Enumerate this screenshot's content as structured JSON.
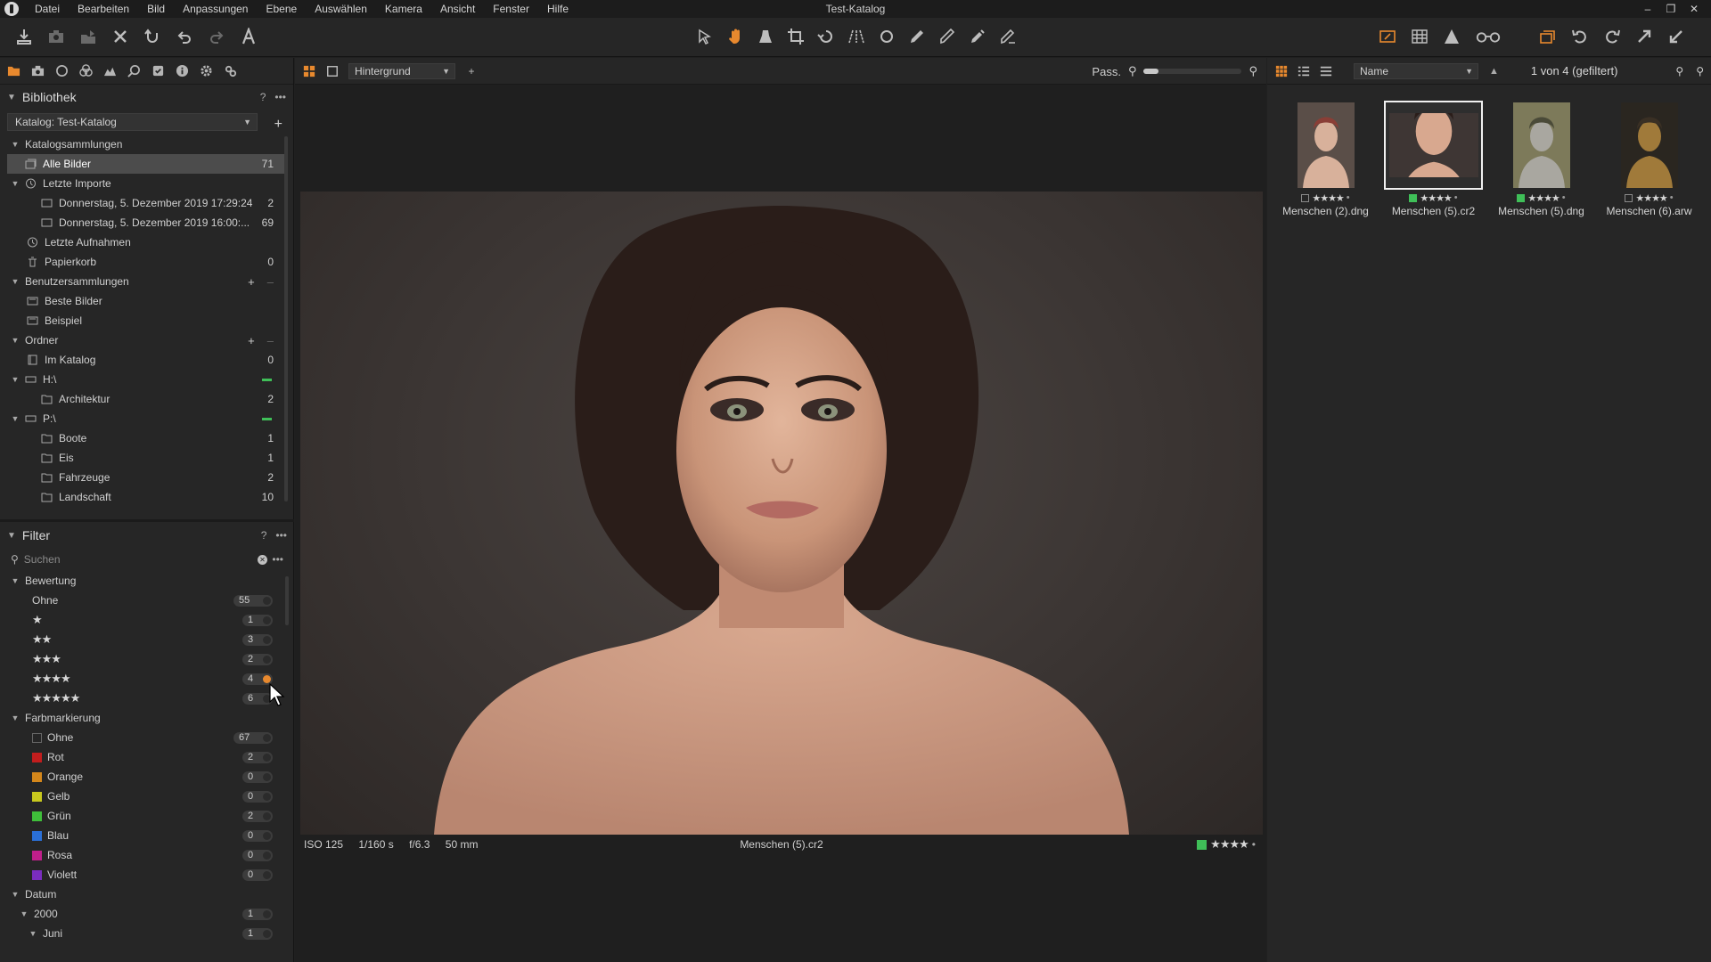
{
  "window": {
    "title": "Test-Katalog"
  },
  "menu": [
    "Datei",
    "Bearbeiten",
    "Bild",
    "Anpassungen",
    "Ebene",
    "Auswählen",
    "Kamera",
    "Ansicht",
    "Fenster",
    "Hilfe"
  ],
  "colors": {
    "accent": "#e8892e",
    "green_label": "#3fbf58",
    "selected_row": "#4c4c4c"
  },
  "library": {
    "title": "Bibliothek",
    "catalog_select": "Katalog: Test-Katalog",
    "sections": {
      "catalog_collections": "Katalogsammlungen",
      "user_collections": "Benutzersammlungen",
      "folders": "Ordner"
    },
    "all_images": {
      "label": "Alle Bilder",
      "count": "71"
    },
    "recent_imports": {
      "label": "Letzte Importe"
    },
    "imports": [
      {
        "label": "Donnerstag, 5. Dezember 2019 17:29:24",
        "count": "2"
      },
      {
        "label": "Donnerstag, 5. Dezember 2019 16:00:...",
        "count": "69"
      }
    ],
    "recent_captures": {
      "label": "Letzte Aufnahmen"
    },
    "trash": {
      "label": "Papierkorb",
      "count": "0"
    },
    "user_items": [
      "Beste Bilder",
      "Beispiel"
    ],
    "in_catalog": {
      "label": "Im Katalog",
      "count": "0"
    },
    "drive_h": {
      "label": "H:\\"
    },
    "drive_h_children": [
      {
        "label": "Architektur",
        "count": "2"
      }
    ],
    "drive_p": {
      "label": "P:\\"
    },
    "drive_p_children": [
      {
        "label": "Boote",
        "count": "1"
      },
      {
        "label": "Eis",
        "count": "1"
      },
      {
        "label": "Fahrzeuge",
        "count": "2"
      },
      {
        "label": "Landschaft",
        "count": "10"
      }
    ]
  },
  "filter": {
    "title": "Filter",
    "search_placeholder": "Suchen",
    "rating_section": "Bewertung",
    "ratings": [
      {
        "label": "Ohne",
        "stars": 0,
        "count": "55"
      },
      {
        "label": "★",
        "stars": 1,
        "count": "1"
      },
      {
        "label": "★★",
        "stars": 2,
        "count": "3"
      },
      {
        "label": "★★★",
        "stars": 3,
        "count": "2"
      },
      {
        "label": "★★★★",
        "stars": 4,
        "count": "4"
      },
      {
        "label": "★★★★★",
        "stars": 5,
        "count": "6"
      }
    ],
    "color_section": "Farbmarkierung",
    "colors": [
      {
        "label": "Ohne",
        "color": "transparent",
        "count": "67"
      },
      {
        "label": "Rot",
        "color": "#c21d1d",
        "count": "2"
      },
      {
        "label": "Orange",
        "color": "#d4871b",
        "count": "0"
      },
      {
        "label": "Gelb",
        "color": "#c8c81e",
        "count": "0"
      },
      {
        "label": "Grün",
        "color": "#3fbf3a",
        "count": "2"
      },
      {
        "label": "Blau",
        "color": "#2a6fd6",
        "count": "0"
      },
      {
        "label": "Rosa",
        "color": "#c01f8a",
        "count": "0"
      },
      {
        "label": "Violett",
        "color": "#7a2dc0",
        "count": "0"
      }
    ],
    "date_section": "Datum",
    "dates": [
      {
        "label": "2000",
        "count": "1"
      },
      {
        "label": "Juni",
        "count": "1"
      }
    ]
  },
  "viewer": {
    "layer_select": "Hintergrund",
    "zoom_label": "Pass.",
    "zoom_fraction": 0.15,
    "exif": {
      "iso": "ISO 125",
      "shutter": "1/160 s",
      "aperture": "f/6.3",
      "focal": "50 mm"
    },
    "filename": "Menschen (5).cr2",
    "rating_stars": "★★★★"
  },
  "browser": {
    "sort_select": "Name",
    "count_text": "1 von 4 (gefiltert)",
    "thumbnails": [
      {
        "name": "Menschen (2).dng",
        "stars": "★★★★",
        "green": false,
        "selected": false
      },
      {
        "name": "Menschen (5).cr2",
        "stars": "★★★★",
        "green": true,
        "selected": true
      },
      {
        "name": "Menschen (5).dng",
        "stars": "★★★★",
        "green": true,
        "selected": false
      },
      {
        "name": "Menschen (6).arw",
        "stars": "★★★★",
        "green": false,
        "selected": false
      }
    ]
  }
}
